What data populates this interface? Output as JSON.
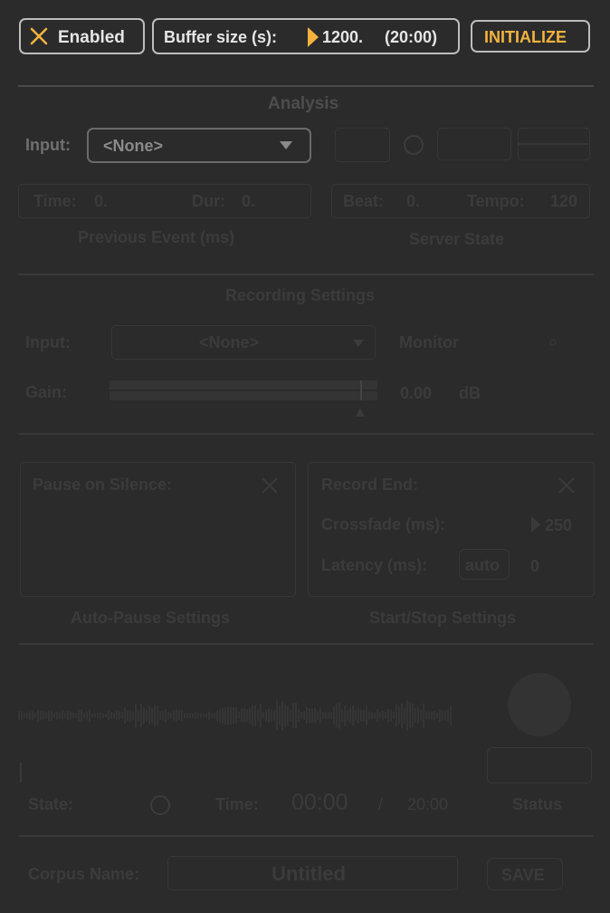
{
  "top": {
    "enabled_label": "Enabled",
    "buffer_label": "Buffer size (s):",
    "buffer_value": "1200.",
    "buffer_time": "(20:00)",
    "initialize_label": "INITIALIZE"
  },
  "analysis": {
    "title": "Analysis",
    "input_label": "Input:",
    "input_value": "<None>",
    "time_label": "Time:",
    "time_value": "0.",
    "dur_label": "Dur:",
    "dur_value": "0.",
    "beat_label": "Beat:",
    "beat_value": "0.",
    "tempo_label": "Tempo:",
    "tempo_value": "120",
    "prev_event_caption": "Previous Event (ms)",
    "server_state_caption": "Server State"
  },
  "recording": {
    "title": "Recording Settings",
    "input_label": "Input:",
    "input_value": "<None>",
    "monitor_label": "Monitor",
    "gain_label": "Gain:",
    "gain_value": "0.00",
    "gain_unit": "dB"
  },
  "autopause": {
    "pause_label": "Pause on Silence:",
    "caption": "Auto-Pause Settings"
  },
  "startstop": {
    "record_end_label": "Record End:",
    "crossfade_label": "Crossfade (ms):",
    "crossfade_value": "250",
    "latency_label": "Latency (ms):",
    "auto_label": "auto",
    "latency_value": "0",
    "caption": "Start/Stop Settings"
  },
  "transport": {
    "state_label": "State:",
    "time_label": "Time:",
    "time_value": "00:00",
    "slash": "/",
    "total_time": "20:00",
    "status_label": "Status"
  },
  "corpus": {
    "name_label": "Corpus Name:",
    "name_value": "Untitled",
    "save_label": "SAVE"
  },
  "colors": {
    "background": "#2b2b2b",
    "accent": "#f4b33e",
    "active_text": "#e6e6e6",
    "inactive": "#3b3b3b"
  }
}
